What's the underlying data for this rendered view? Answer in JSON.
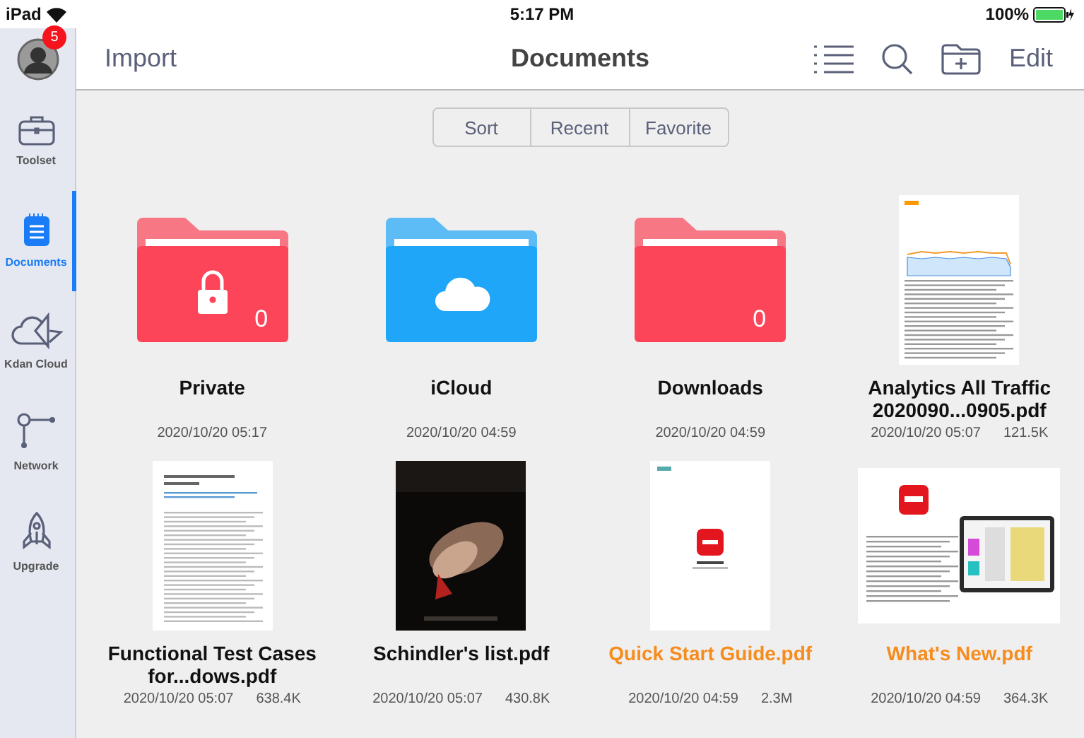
{
  "status_bar": {
    "device": "iPad",
    "time": "5:17 PM",
    "battery": "100%"
  },
  "sidebar": {
    "badge": "5",
    "items": [
      {
        "label": "Toolset",
        "selected": false
      },
      {
        "label": "Documents",
        "selected": true
      },
      {
        "label": "Kdan Cloud",
        "selected": false
      },
      {
        "label": "Network",
        "selected": false
      },
      {
        "label": "Upgrade",
        "selected": false
      }
    ]
  },
  "nav": {
    "left": "Import",
    "title": "Documents",
    "right": "Edit"
  },
  "segments": [
    {
      "label": "Sort",
      "selected": false
    },
    {
      "label": "Recent",
      "selected": false
    },
    {
      "label": "Favorite",
      "selected": false
    }
  ],
  "items": [
    {
      "kind": "folder",
      "name": "Private",
      "date": "2020/10/20 05:17",
      "color": "#fc4558",
      "count": "0"
    },
    {
      "kind": "folder",
      "name": "iCloud",
      "date": "2020/10/20 04:59",
      "color": "#1fa6f8"
    },
    {
      "kind": "folder",
      "name": "Downloads",
      "date": "2020/10/20 04:59",
      "color": "#fc4558",
      "count": "0"
    },
    {
      "kind": "file",
      "name": "Analytics All Traffic 2020090...0905.pdf",
      "date": "2020/10/20 05:07",
      "size": "121.5K",
      "unread": false
    },
    {
      "kind": "file",
      "name": "Functional Test Cases for...dows.pdf",
      "date": "2020/10/20 05:07",
      "size": "638.4K",
      "unread": false
    },
    {
      "kind": "file",
      "name": "Schindler's list.pdf",
      "date": "2020/10/20 05:07",
      "size": "430.8K",
      "unread": false
    },
    {
      "kind": "file",
      "name": "Quick Start Guide.pdf",
      "date": "2020/10/20 04:59",
      "size": "2.3M",
      "unread": true
    },
    {
      "kind": "file",
      "name": "What's New.pdf",
      "date": "2020/10/20 04:59",
      "size": "364.3K",
      "unread": true
    }
  ]
}
